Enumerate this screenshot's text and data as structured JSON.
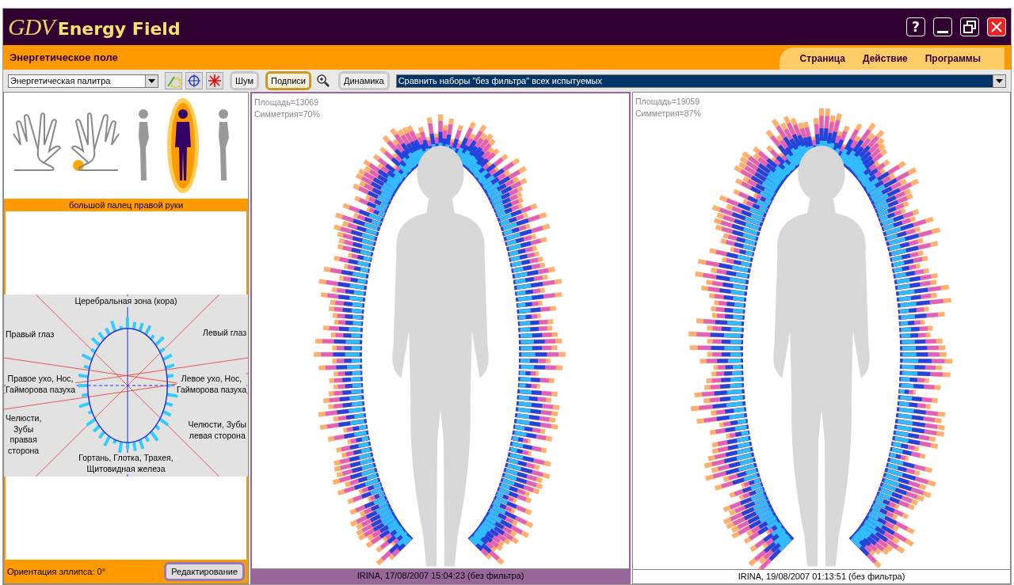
{
  "window": {
    "logo_script": "GDV",
    "logo_text": "Energy Field",
    "help_label": "?"
  },
  "page_title": "Энергетическое поле",
  "menu": [
    "Страница",
    "Действие",
    "Программы"
  ],
  "toolbar": {
    "palette_select": "Энергетическая палитра",
    "buttons": [
      {
        "label": "Шум",
        "selected": false
      },
      {
        "label": "Подписи",
        "selected": true
      },
      {
        "label": "Динамика",
        "selected": false
      }
    ],
    "compare_select": "Сравнить наборы \"без фильтра\" всех испытуемых"
  },
  "left": {
    "figures": [
      {
        "kind": "hand-left",
        "selected": false,
        "thumb_highlighted": false
      },
      {
        "kind": "hand-right",
        "selected": false,
        "thumb_highlighted": true
      },
      {
        "kind": "body-side",
        "selected": false
      },
      {
        "kind": "body-front",
        "selected": true
      },
      {
        "kind": "body-side",
        "selected": false
      }
    ],
    "sector_caption": "большой палец правой руки",
    "zones": [
      "Церебральная зона (кора)",
      "Правый глаз",
      "Левый глаз",
      "Правое ухо, Нос,\nГайморова пазуха",
      "Левое ухо, Нос,\nГайморова пазуха",
      "Челюсти,\nЗубы\nправая\nсторона",
      "Челюсти, Зубы\nлевая сторона",
      "Гортань, Глотка, Трахея,\nЩитовидная железа"
    ],
    "orientation": "Ориентация эллипса: 0°",
    "edit_button": "Редактирование"
  },
  "panels": [
    {
      "area": "Площадь=13069",
      "symmetry": "Симметрия=70%",
      "caption": "IRINA, 17/08/2007 15:04:23 (без фильтра)",
      "selected": true
    },
    {
      "area": "Площадь=19059",
      "symmetry": "Симметрия=87%",
      "caption": "IRINA, 19/08/2007 01:13:51 (без фильтра)",
      "selected": false
    }
  ]
}
